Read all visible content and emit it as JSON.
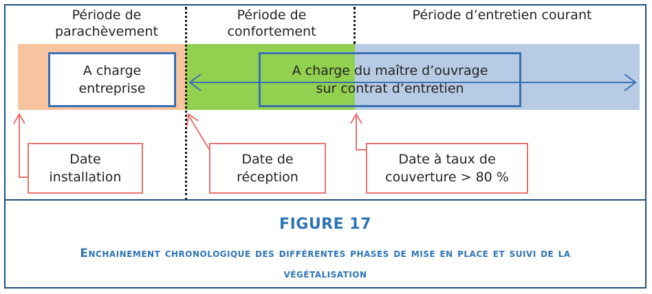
{
  "colors": {
    "frame": "#1f4e79",
    "band_parachevement": "#f8c49f",
    "band_confortement": "#92d050",
    "band_entretien": "#b7cce4",
    "box_blue": "#3a6fb0",
    "box_red": "#e8726f",
    "caption": "#2e74b5"
  },
  "phases": [
    {
      "label": "Période de parachèvement"
    },
    {
      "label": "Période de confortement"
    },
    {
      "label": "Période d’entretien courant"
    }
  ],
  "responsibility": {
    "entreprise": "A charge entreprise",
    "maitre_ouvrage_line1": "A charge du maître d’ouvrage",
    "maitre_ouvrage_line2": "sur contrat d’entretien"
  },
  "milestones": [
    {
      "label": "Date installation"
    },
    {
      "label": "Date de réception"
    },
    {
      "label": "Date à taux de couverture > 80 %"
    }
  ],
  "caption": {
    "title": "FIGURE 17",
    "subtitle": "Enchainement chronologique des différentes phases de mise en place et suivi de la végétalisation"
  }
}
